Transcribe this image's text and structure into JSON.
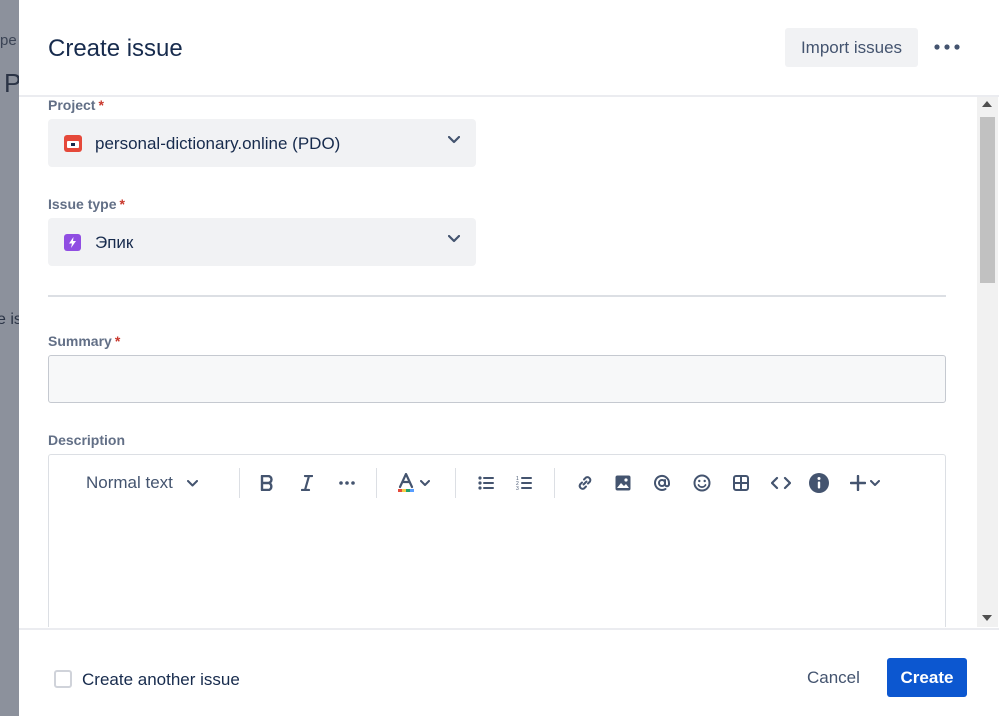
{
  "background": {
    "fragment_1": "pe",
    "fragment_2": "P",
    "fragment_3": "e is"
  },
  "dialog": {
    "title": "Create issue",
    "import_label": "Import issues",
    "more_icon": "more-horizontal-icon"
  },
  "fields": {
    "project": {
      "label": "Project",
      "required_mark": "*",
      "value": "personal-dictionary.online (PDO)",
      "icon": "project-icon"
    },
    "issue_type": {
      "label": "Issue type",
      "required_mark": "*",
      "value": "Эпик",
      "icon": "epic-icon"
    },
    "summary": {
      "label": "Summary",
      "required_mark": "*",
      "value": ""
    },
    "description": {
      "label": "Description"
    }
  },
  "editor_toolbar": {
    "text_style": "Normal text",
    "tools": [
      "bold-icon",
      "italic-icon",
      "more-formatting-icon",
      "text-color-icon",
      "bullet-list-icon",
      "numbered-list-icon",
      "link-icon",
      "image-icon",
      "mention-icon",
      "emoji-icon",
      "table-icon",
      "code-icon",
      "info-icon",
      "insert-plus-icon"
    ]
  },
  "footer": {
    "create_another_label": "Create another issue",
    "cancel_label": "Cancel",
    "create_label": "Create"
  },
  "colors": {
    "primary": "#0c57d0",
    "required": "#c9372c",
    "project_icon": "#e5493a",
    "epic_icon": "#904ee2",
    "text": "#172b4d"
  }
}
